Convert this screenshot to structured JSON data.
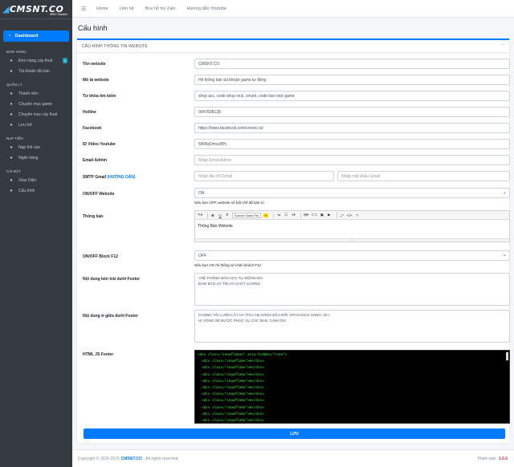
{
  "brand": {
    "logo": "CMSNT.CO",
    "sub": "MMO Solution"
  },
  "sidebar": {
    "dashboard": "Dashboard",
    "sections": [
      {
        "header": "ĐƠN HÀNG",
        "items": [
          {
            "label": "Đơn hàng cày thuê",
            "icon": "cart-icon",
            "badge": "0"
          },
          {
            "label": "Tài khoản đã bán",
            "icon": "list-icon"
          }
        ]
      },
      {
        "header": "QUẢN LÝ",
        "items": [
          {
            "label": "Thành viên",
            "icon": "users-icon"
          },
          {
            "label": "Chuyên mục game",
            "icon": "folder-icon"
          },
          {
            "label": "Chuyên mục cày thuê",
            "icon": "folder-icon"
          },
          {
            "label": "Lưu trữ",
            "icon": "chart-icon"
          }
        ]
      },
      {
        "header": "NẠP TIỀN",
        "items": [
          {
            "label": "Nạp thẻ cào",
            "icon": "card-icon"
          },
          {
            "label": "Ngân hàng",
            "icon": "bank-icon"
          }
        ]
      },
      {
        "header": "CÀI ĐẶT",
        "items": [
          {
            "label": "Giao Diện",
            "icon": "image-icon"
          },
          {
            "label": "Cấu hình",
            "icon": "gear-icon"
          }
        ]
      }
    ]
  },
  "topnav": {
    "items": [
      "Home",
      "Liên hệ",
      "Box hỗ trợ Zalo",
      "Hướng dẫn Youtube"
    ]
  },
  "page": {
    "title": "Cấu hình"
  },
  "card": {
    "header": "CẤU HÌNH THÔNG TIN WEBSITE"
  },
  "form": {
    "title_label": "Tên website",
    "title_value": "CMSNT.CO",
    "desc_label": "Mô tả website",
    "desc_value": "Hệ thống bán tài khoản game tự động",
    "keywords_label": "Từ khóa tìm kiếm",
    "keywords_value": "shop acc, code shop nick, cmsnt, code ban nick game",
    "hotline_label": "Hotline",
    "hotline_value": "0947838128",
    "facebook_label": "Facebook",
    "facebook_value": "https://www.facebook.com/cmsnt.co/",
    "youtube_label": "ID Video Youtube",
    "youtube_value": "5WRqOmxz8Pc",
    "email_label": "Email Admin",
    "email_placeholder": "Nhập Email Admin",
    "smtp_label": "SMTP Gmail",
    "smtp_link": "(HƯỚNG DẪN)",
    "smtp_addr_placeholder": "Nhập địa chỉ Gmail",
    "smtp_pass_placeholder": "Nhập mật khẩu Gmail",
    "onoff_label": "ON/OFF Website",
    "onoff_value": "ON",
    "onoff_help": "Nếu bạn OFF, website sẽ bật chế độ bảo trì.",
    "notice_label": "Thông báo",
    "notice_font": "Source Sans Pro",
    "notice_value": "Thông Báo Website",
    "f12_label": "ON/OFF Block F12",
    "f12_value": "OFF",
    "f12_help": "Nếu bạn ON hệ thống sẽ chặn khách F12",
    "footer_left_label": "Nội dung bên trái dưới Footer",
    "footer_left_value": "<HỆ THỐNG BÁN ACC TỰ ĐỘNG<br>\nĐẢM BẢO UY TÍN VÀ CHẤT LƯỢNG.",
    "footer_mid_label": "Nội dung ở giữa dưới Footer",
    "footer_mid_value": "CHÚNG TÔI LUÔN LẤY UY TÍN LÀM HÀNG ĐẦU ĐỐI VỚI KHÁCH HÀNG.<br>\nHI VỌNG SẼ ĐƯỢC PHỤC VỤ CÁC BẠN. CẢM ƠN!",
    "js_label": "HTML JS Footer",
    "js_lines": [
      "<div class=\"snowflakes\" aria-hidden=\"true\">",
      "  <div class=\"snowflake\">❄</div>",
      "  <div class=\"snowflake\">❄</div>",
      "  <div class=\"snowflake\">❄</div>",
      "  <div class=\"snowflake\">❄</div>",
      "  <div class=\"snowflake\">❄</div>",
      "  <div class=\"snowflake\">❄</div>",
      "  <div class=\"snowflake\">❄</div>",
      "  <div class=\"snowflake\">❄</div>",
      "  <div class=\"snowflake\">❄</div>",
      "  <div class=\"snowflake\">❄</div>",
      "  <div class=\"snowflake\">❄</div>"
    ],
    "save_label": "LƯU"
  },
  "footer": {
    "copyright_prefix": "Copyright © 2020-2021",
    "brand": "CMSNT.CO",
    "copyright_suffix": ". All rights reserved.",
    "version_label": "Phiên bản",
    "version": "1.0.0"
  }
}
